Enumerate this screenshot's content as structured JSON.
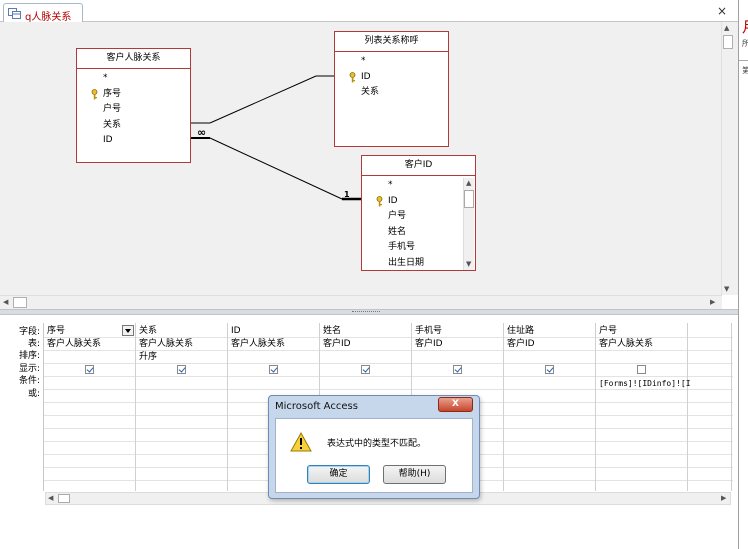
{
  "window": {
    "tab_label": "q人脉关系",
    "close_symbol": "×"
  },
  "side_pane": {
    "glyph1": "月",
    "glyph2": "所",
    "glyph3": "第"
  },
  "tables": [
    {
      "title": "客户人脉关系",
      "fields": [
        {
          "label": "*",
          "key": false
        },
        {
          "label": "序号",
          "key": true
        },
        {
          "label": "户号",
          "key": false
        },
        {
          "label": "关系",
          "key": false
        },
        {
          "label": "ID",
          "key": false
        }
      ]
    },
    {
      "title": "列表关系称呼",
      "fields": [
        {
          "label": "*",
          "key": false
        },
        {
          "label": "ID",
          "key": true
        },
        {
          "label": "关系",
          "key": false
        }
      ]
    },
    {
      "title": "客户ID",
      "fields": [
        {
          "label": "*",
          "key": false
        },
        {
          "label": "ID",
          "key": true
        },
        {
          "label": "户号",
          "key": false
        },
        {
          "label": "姓名",
          "key": false
        },
        {
          "label": "手机号",
          "key": false
        },
        {
          "label": "出生日期",
          "key": false
        }
      ]
    }
  ],
  "relationships": {
    "one_symbol": "1",
    "many_symbol": "∞"
  },
  "grid": {
    "row_labels": [
      "字段:",
      "表:",
      "排序:",
      "显示:",
      "条件:",
      "或:"
    ],
    "columns": [
      {
        "field": "序号",
        "table": "客户人脉关系",
        "sort": "",
        "show": true,
        "criteria": ""
      },
      {
        "field": "关系",
        "table": "客户人脉关系",
        "sort": "升序",
        "show": true,
        "criteria": ""
      },
      {
        "field": "ID",
        "table": "客户人脉关系",
        "sort": "",
        "show": true,
        "criteria": ""
      },
      {
        "field": "姓名",
        "table": "客户ID",
        "sort": "",
        "show": true,
        "criteria": ""
      },
      {
        "field": "手机号",
        "table": "客户ID",
        "sort": "",
        "show": true,
        "criteria": ""
      },
      {
        "field": "住址路",
        "table": "客户ID",
        "sort": "",
        "show": true,
        "criteria": ""
      },
      {
        "field": "户号",
        "table": "客户人脉关系",
        "sort": "",
        "show": false,
        "criteria": "[Forms]![IDinfo]![I"
      },
      {
        "field": "",
        "table": "",
        "sort": "",
        "show": null,
        "criteria": ""
      }
    ]
  },
  "dialog": {
    "title": "Microsoft Access",
    "close_label": "X",
    "message": "表达式中的类型不匹配。",
    "ok_label": "确定",
    "help_label": "帮助(H)"
  },
  "colors": {
    "table_border": "#b03a3a",
    "tab_text": "#b30000",
    "dialog_frame": "#c6d7ec",
    "close_red": "#c8452b"
  }
}
